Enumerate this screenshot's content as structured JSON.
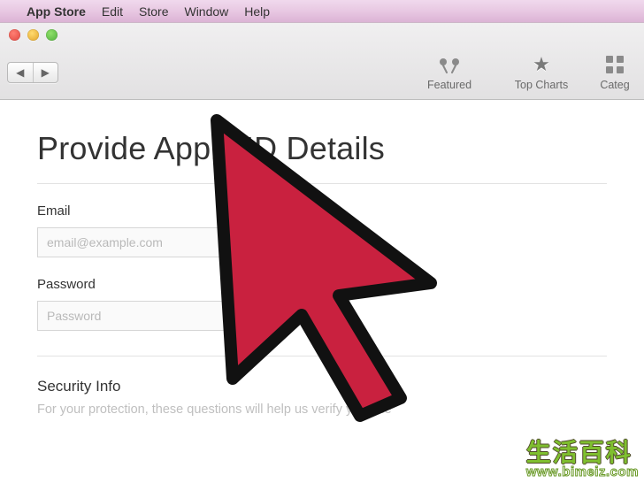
{
  "menubar": {
    "app_name": "App Store",
    "items": [
      "Edit",
      "Store",
      "Window",
      "Help"
    ]
  },
  "toolbar": {
    "tabs": [
      {
        "label": "Featured",
        "icon": "featured-icon"
      },
      {
        "label": "Top Charts",
        "icon": "top-charts-icon"
      },
      {
        "label": "Categ",
        "icon": "categories-icon"
      }
    ]
  },
  "page": {
    "title": "Provide Apple ID Details",
    "email_label": "Email",
    "email_placeholder": "email@example.com",
    "password_label": "Password",
    "password_placeholder": "Password",
    "security_title": "Security Info",
    "security_desc": "For your protection, these questions will help us verify your ide"
  },
  "watermark": {
    "cn": "生活百科",
    "url": "www.bimeiz.com"
  }
}
